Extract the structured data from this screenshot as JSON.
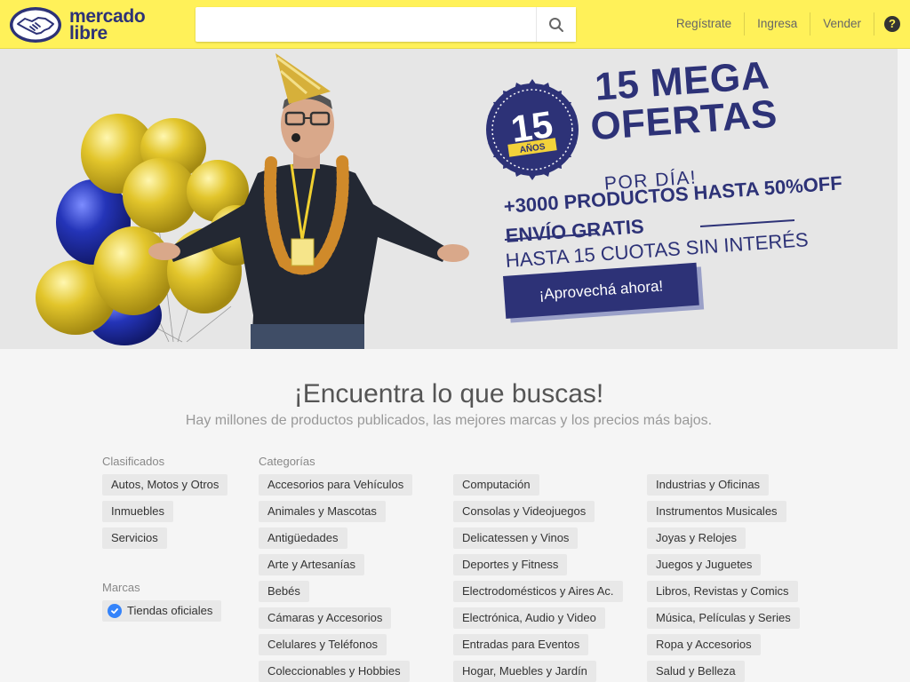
{
  "header": {
    "logo_line1": "mercado",
    "logo_line2": "libre",
    "search_placeholder": "",
    "nav": [
      "Regístrate",
      "Ingresa",
      "Vender"
    ],
    "help_symbol": "?"
  },
  "banner": {
    "badge_number": "15",
    "badge_label": "AÑOS",
    "title_line1": "15 MEGA",
    "title_line2": "OFERTAS",
    "por_dia": "POR DÍA!",
    "promo1": "+3000 PRODUCTOS HASTA 50%OFF",
    "promo2": "ENVÍO GRATIS",
    "promo3": "HASTA 15 CUOTAS SIN INTERÉS",
    "cta": "¡Aprovechá ahora!"
  },
  "main": {
    "title": "¡Encuentra lo que buscas!",
    "subtitle": "Hay millones de productos publicados, las mejores marcas y los precios más bajos."
  },
  "clasificados": {
    "heading": "Clasificados",
    "items": [
      "Autos, Motos y Otros",
      "Inmuebles",
      "Servicios"
    ]
  },
  "marcas": {
    "heading": "Marcas",
    "official": "Tiendas oficiales"
  },
  "categorias": {
    "heading": "Categorías",
    "col1": [
      "Accesorios para Vehículos",
      "Animales y Mascotas",
      "Antigüedades",
      "Arte y Artesanías",
      "Bebés",
      "Cámaras y Accesorios",
      "Celulares y Teléfonos",
      "Coleccionables y Hobbies"
    ],
    "col2": [
      "Computación",
      "Consolas y Videojuegos",
      "Delicatessen y Vinos",
      "Deportes y Fitness",
      "Electrodomésticos y Aires Ac.",
      "Electrónica, Audio y Video",
      "Entradas para Eventos",
      "Hogar, Muebles y Jardín"
    ],
    "col3": [
      "Industrias y Oficinas",
      "Instrumentos Musicales",
      "Joyas y Relojes",
      "Juegos y Juguetes",
      "Libros, Revistas y Comics",
      "Música, Películas y Series",
      "Ropa y Accesorios",
      "Salud y Belleza"
    ]
  },
  "colors": {
    "brand_yellow": "#fff159",
    "brand_navy": "#2d3277",
    "balloon_gold": "#e2c52b",
    "balloon_blue": "#2434b8",
    "verified_blue": "#3483fa"
  }
}
